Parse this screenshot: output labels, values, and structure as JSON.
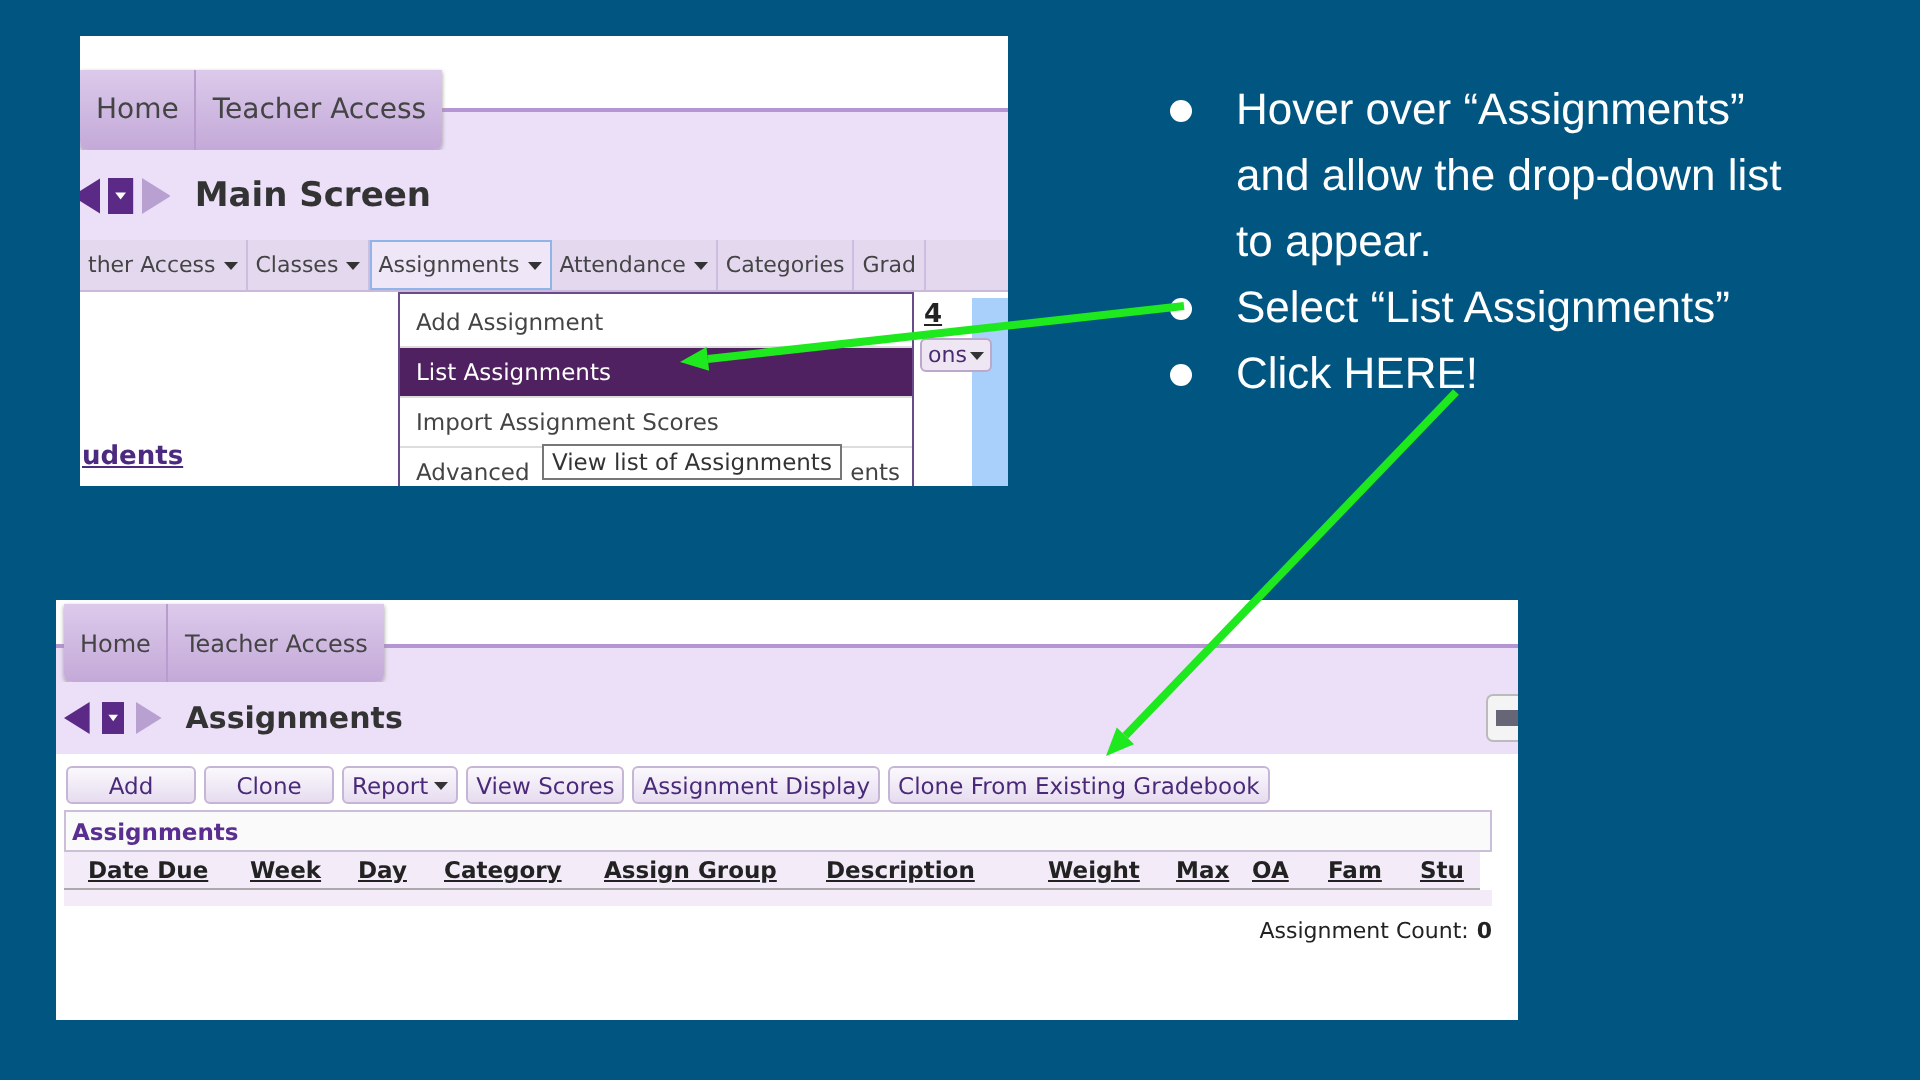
{
  "slide": {
    "bullets": [
      {
        "text": "Hover over “Assignments” and allow the drop-down list to appear."
      },
      {
        "text": "Select “List Assignments”"
      },
      {
        "text": "Click HERE!"
      }
    ]
  },
  "screenshot_1": {
    "tabs": [
      {
        "label": "Home"
      },
      {
        "label": "Teacher Access"
      }
    ],
    "title": "Main Screen",
    "menu_bar": [
      {
        "label": "ther Access",
        "dropdown": true,
        "selected": false
      },
      {
        "label": "Classes",
        "dropdown": true,
        "selected": false
      },
      {
        "label": "Assignments",
        "dropdown": true,
        "selected": true
      },
      {
        "label": "Attendance",
        "dropdown": true,
        "selected": false
      },
      {
        "label": "Categories",
        "dropdown": false,
        "selected": false
      },
      {
        "label": "Grad",
        "dropdown": false,
        "selected": false
      }
    ],
    "dropdown_menu": [
      {
        "label": "Add Assignment",
        "selected": false
      },
      {
        "label": "List Assignments",
        "selected": true
      },
      {
        "label": "Import Assignment Scores",
        "selected": false
      },
      {
        "label": "Advanced",
        "trailing": "ents",
        "selected": false
      }
    ],
    "tooltip": "View list of Assignments",
    "column_header": "4",
    "options_button": "ons",
    "students_link": "udents"
  },
  "screenshot_2": {
    "tabs": [
      {
        "label": "Home"
      },
      {
        "label": "Teacher Access"
      }
    ],
    "title": "Assignments",
    "buttons": [
      {
        "label": "Add",
        "dropdown": false
      },
      {
        "label": "Clone",
        "dropdown": false
      },
      {
        "label": "Report",
        "dropdown": true
      },
      {
        "label": "View Scores",
        "dropdown": false
      },
      {
        "label": "Assignment Display",
        "dropdown": false
      },
      {
        "label": "Clone From Existing Gradebook",
        "dropdown": false
      }
    ],
    "panel_title": "Assignments",
    "table": {
      "columns": [
        "Date Due",
        "Week",
        "Day",
        "Category",
        "Assign Group",
        "Description",
        "Weight",
        "Max",
        "OA",
        "Fam",
        "Stu"
      ]
    },
    "count_label": "Assignment Count:",
    "count_value": "0"
  }
}
